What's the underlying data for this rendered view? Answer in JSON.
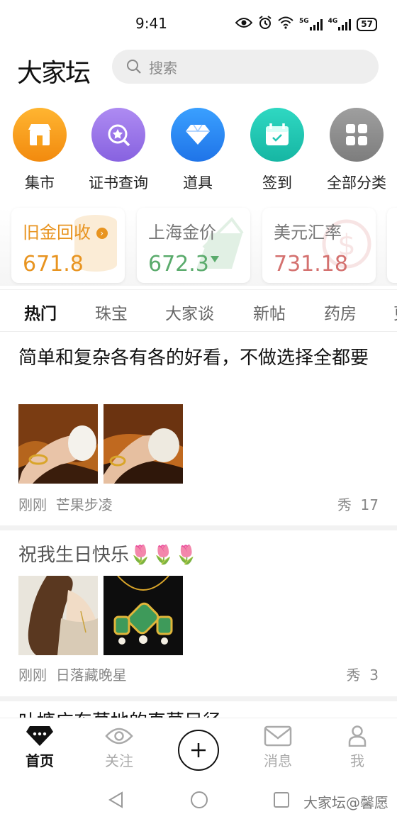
{
  "status_bar": {
    "time": "9:41",
    "network_5g": "5G",
    "network_4g": "4G",
    "battery": "57"
  },
  "header": {
    "logo": "大家坛",
    "search_placeholder": "搜索"
  },
  "quick_links": [
    {
      "label": "集市",
      "icon": "shop-icon",
      "color": "#f8a21c"
    },
    {
      "label": "证书查询",
      "icon": "certificate-search-icon",
      "color": "#9b74e8"
    },
    {
      "label": "道具",
      "icon": "diamond-icon",
      "color": "#2f8cf0"
    },
    {
      "label": "签到",
      "icon": "calendar-icon",
      "color": "#22c7b4"
    },
    {
      "label": "全部分类",
      "icon": "grid-icon",
      "color": "#8e8e8e"
    }
  ],
  "price_cards": [
    {
      "title": "旧金回收",
      "value": "671.8",
      "color": "#e89420"
    },
    {
      "title": "上海金价",
      "value": "672.3",
      "color": "#5aab6c"
    },
    {
      "title": "美元汇率",
      "value": "731.18",
      "color": "#d4716f"
    }
  ],
  "tabs": [
    "热门",
    "珠宝",
    "大家谈",
    "新帖",
    "药房",
    "更"
  ],
  "posts": [
    {
      "title": "简单和复杂各有各的好看，不做选择全都要",
      "time": "刚刚",
      "author": "芒果步凌",
      "tag": "秀",
      "count": "17"
    },
    {
      "title": "祝我生日快乐🌷🌷🌷",
      "time": "刚刚",
      "author": "日落藏晚星",
      "tag": "秀",
      "count": "3"
    },
    {
      "title": "叶塘广东草地的直莫目径"
    }
  ],
  "bottom_nav": {
    "home": "首页",
    "follow": "关注",
    "messages": "消息",
    "me": "我"
  },
  "watermark": "大家坛@馨愿"
}
